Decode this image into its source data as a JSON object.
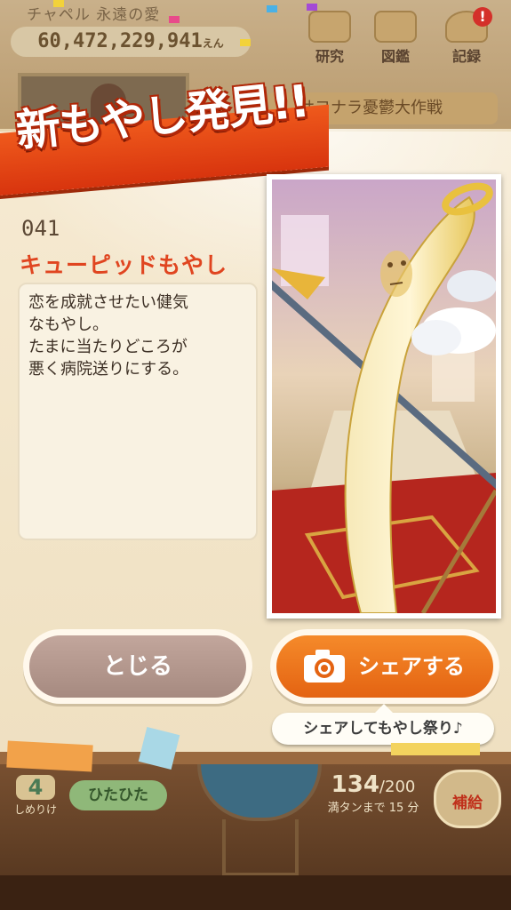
{
  "background": {
    "chapel_title": "チャペル 永遠の愛",
    "money_value": "60,472,229,941",
    "money_unit": "えん",
    "top_buttons": [
      {
        "label": "研究",
        "icon": "flask-icon"
      },
      {
        "label": "図鑑",
        "icon": "book-icon"
      },
      {
        "label": "記録",
        "icon": "trophy-icon",
        "badge": "!"
      }
    ],
    "banner_text": "サヨナラ憂鬱大作戦",
    "level": "4",
    "level_caption": "しめりけ",
    "status_pill": "ひたひた",
    "count_current": "134",
    "count_max": "/200",
    "count_sub": "満タンまで 15 分",
    "supply_label": "補給"
  },
  "modal": {
    "banner_title": "新もやし発見!!",
    "entry_number": "041",
    "entry_name": "キューピッドもやし",
    "description_lines": [
      "恋を成就させたい健気",
      "なもやし。",
      "たまに当たりどころが",
      "悪く病院送りにする。"
    ],
    "close_button": "とじる",
    "share_button": "シェアする",
    "share_tip": "シェアしてもやし祭り♪"
  },
  "colors": {
    "accent_orange": "#e46312",
    "name_red": "#e04520",
    "close_button": "#a68a80",
    "ribbon_red": "#d8340e"
  }
}
